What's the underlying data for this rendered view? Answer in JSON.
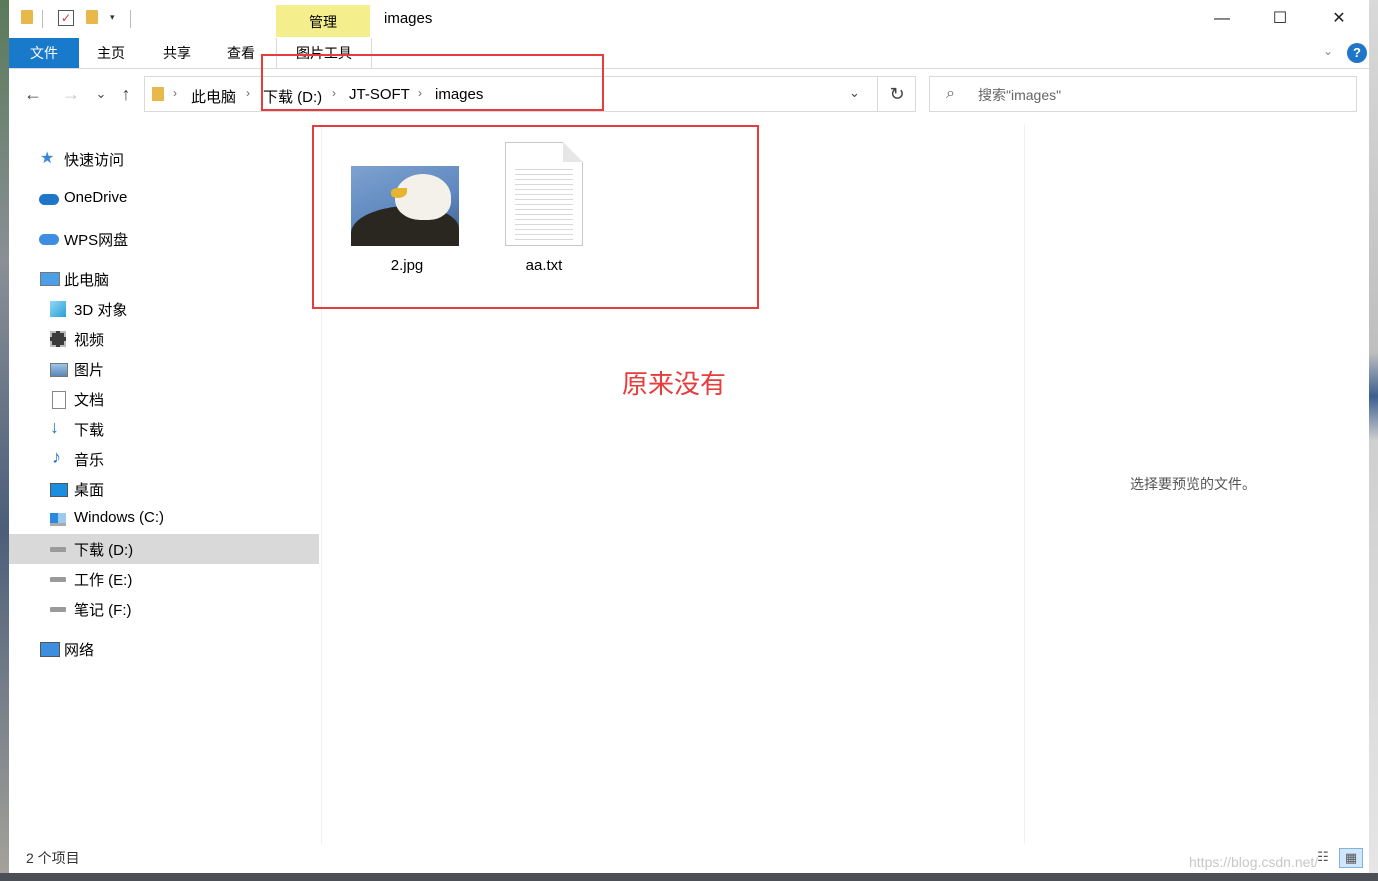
{
  "window": {
    "title": "images",
    "context_tab": "管理",
    "controls": {
      "minimize": "—",
      "maximize": "☐",
      "close": "✕"
    }
  },
  "quick_access_toolbar": {
    "arrow": "▾"
  },
  "ribbon": {
    "tabs": [
      "文件",
      "主页",
      "共享",
      "查看",
      "图片工具"
    ],
    "expand": "⌄",
    "help": "?"
  },
  "navigation": {
    "back": "←",
    "forward": "→",
    "recent": "⌄",
    "up": "↑"
  },
  "address_bar": {
    "separator": "›",
    "crumbs": [
      "此电脑",
      "下载 (D:)",
      "JT-SOFT",
      "images"
    ],
    "dropdown": "⌄",
    "refresh": "↻"
  },
  "search": {
    "placeholder": "搜索\"images\"",
    "icon": "⌕"
  },
  "sidebar": {
    "items": [
      {
        "label": "快速访问",
        "icon": "star-icon"
      },
      {
        "label": "OneDrive",
        "icon": "cloud-icon"
      },
      {
        "label": "WPS网盘",
        "icon": "cloud-icon"
      },
      {
        "label": "此电脑",
        "icon": "computer-icon"
      },
      {
        "label": "3D 对象",
        "icon": "cube-icon"
      },
      {
        "label": "视频",
        "icon": "film-icon"
      },
      {
        "label": "图片",
        "icon": "picture-icon"
      },
      {
        "label": "文档",
        "icon": "document-icon"
      },
      {
        "label": "下载",
        "icon": "download-arrow-icon"
      },
      {
        "label": "音乐",
        "icon": "music-note-icon"
      },
      {
        "label": "桌面",
        "icon": "desktop-icon"
      },
      {
        "label": "Windows (C:)",
        "icon": "windows-drive-icon"
      },
      {
        "label": "下载 (D:)",
        "icon": "drive-icon",
        "selected": true
      },
      {
        "label": "工作 (E:)",
        "icon": "drive-icon"
      },
      {
        "label": "笔记 (F:)",
        "icon": "drive-icon"
      },
      {
        "label": "网络",
        "icon": "network-icon"
      }
    ]
  },
  "files": [
    {
      "name": "2.jpg",
      "type": "image"
    },
    {
      "name": "aa.txt",
      "type": "text"
    }
  ],
  "annotation_text": "原来没有",
  "preview_pane": {
    "message": "选择要预览的文件。"
  },
  "status_bar": {
    "item_count": "2 个项目",
    "details_view": "☷",
    "icons_view": "▦"
  },
  "watermark": "https://blog.csdn.net/",
  "colors": {
    "file_tab": "#1979ca",
    "manage_tab": "#f4ee8d",
    "annotation_red": "#e63c3c",
    "selected_row": "#d9d9d9"
  }
}
